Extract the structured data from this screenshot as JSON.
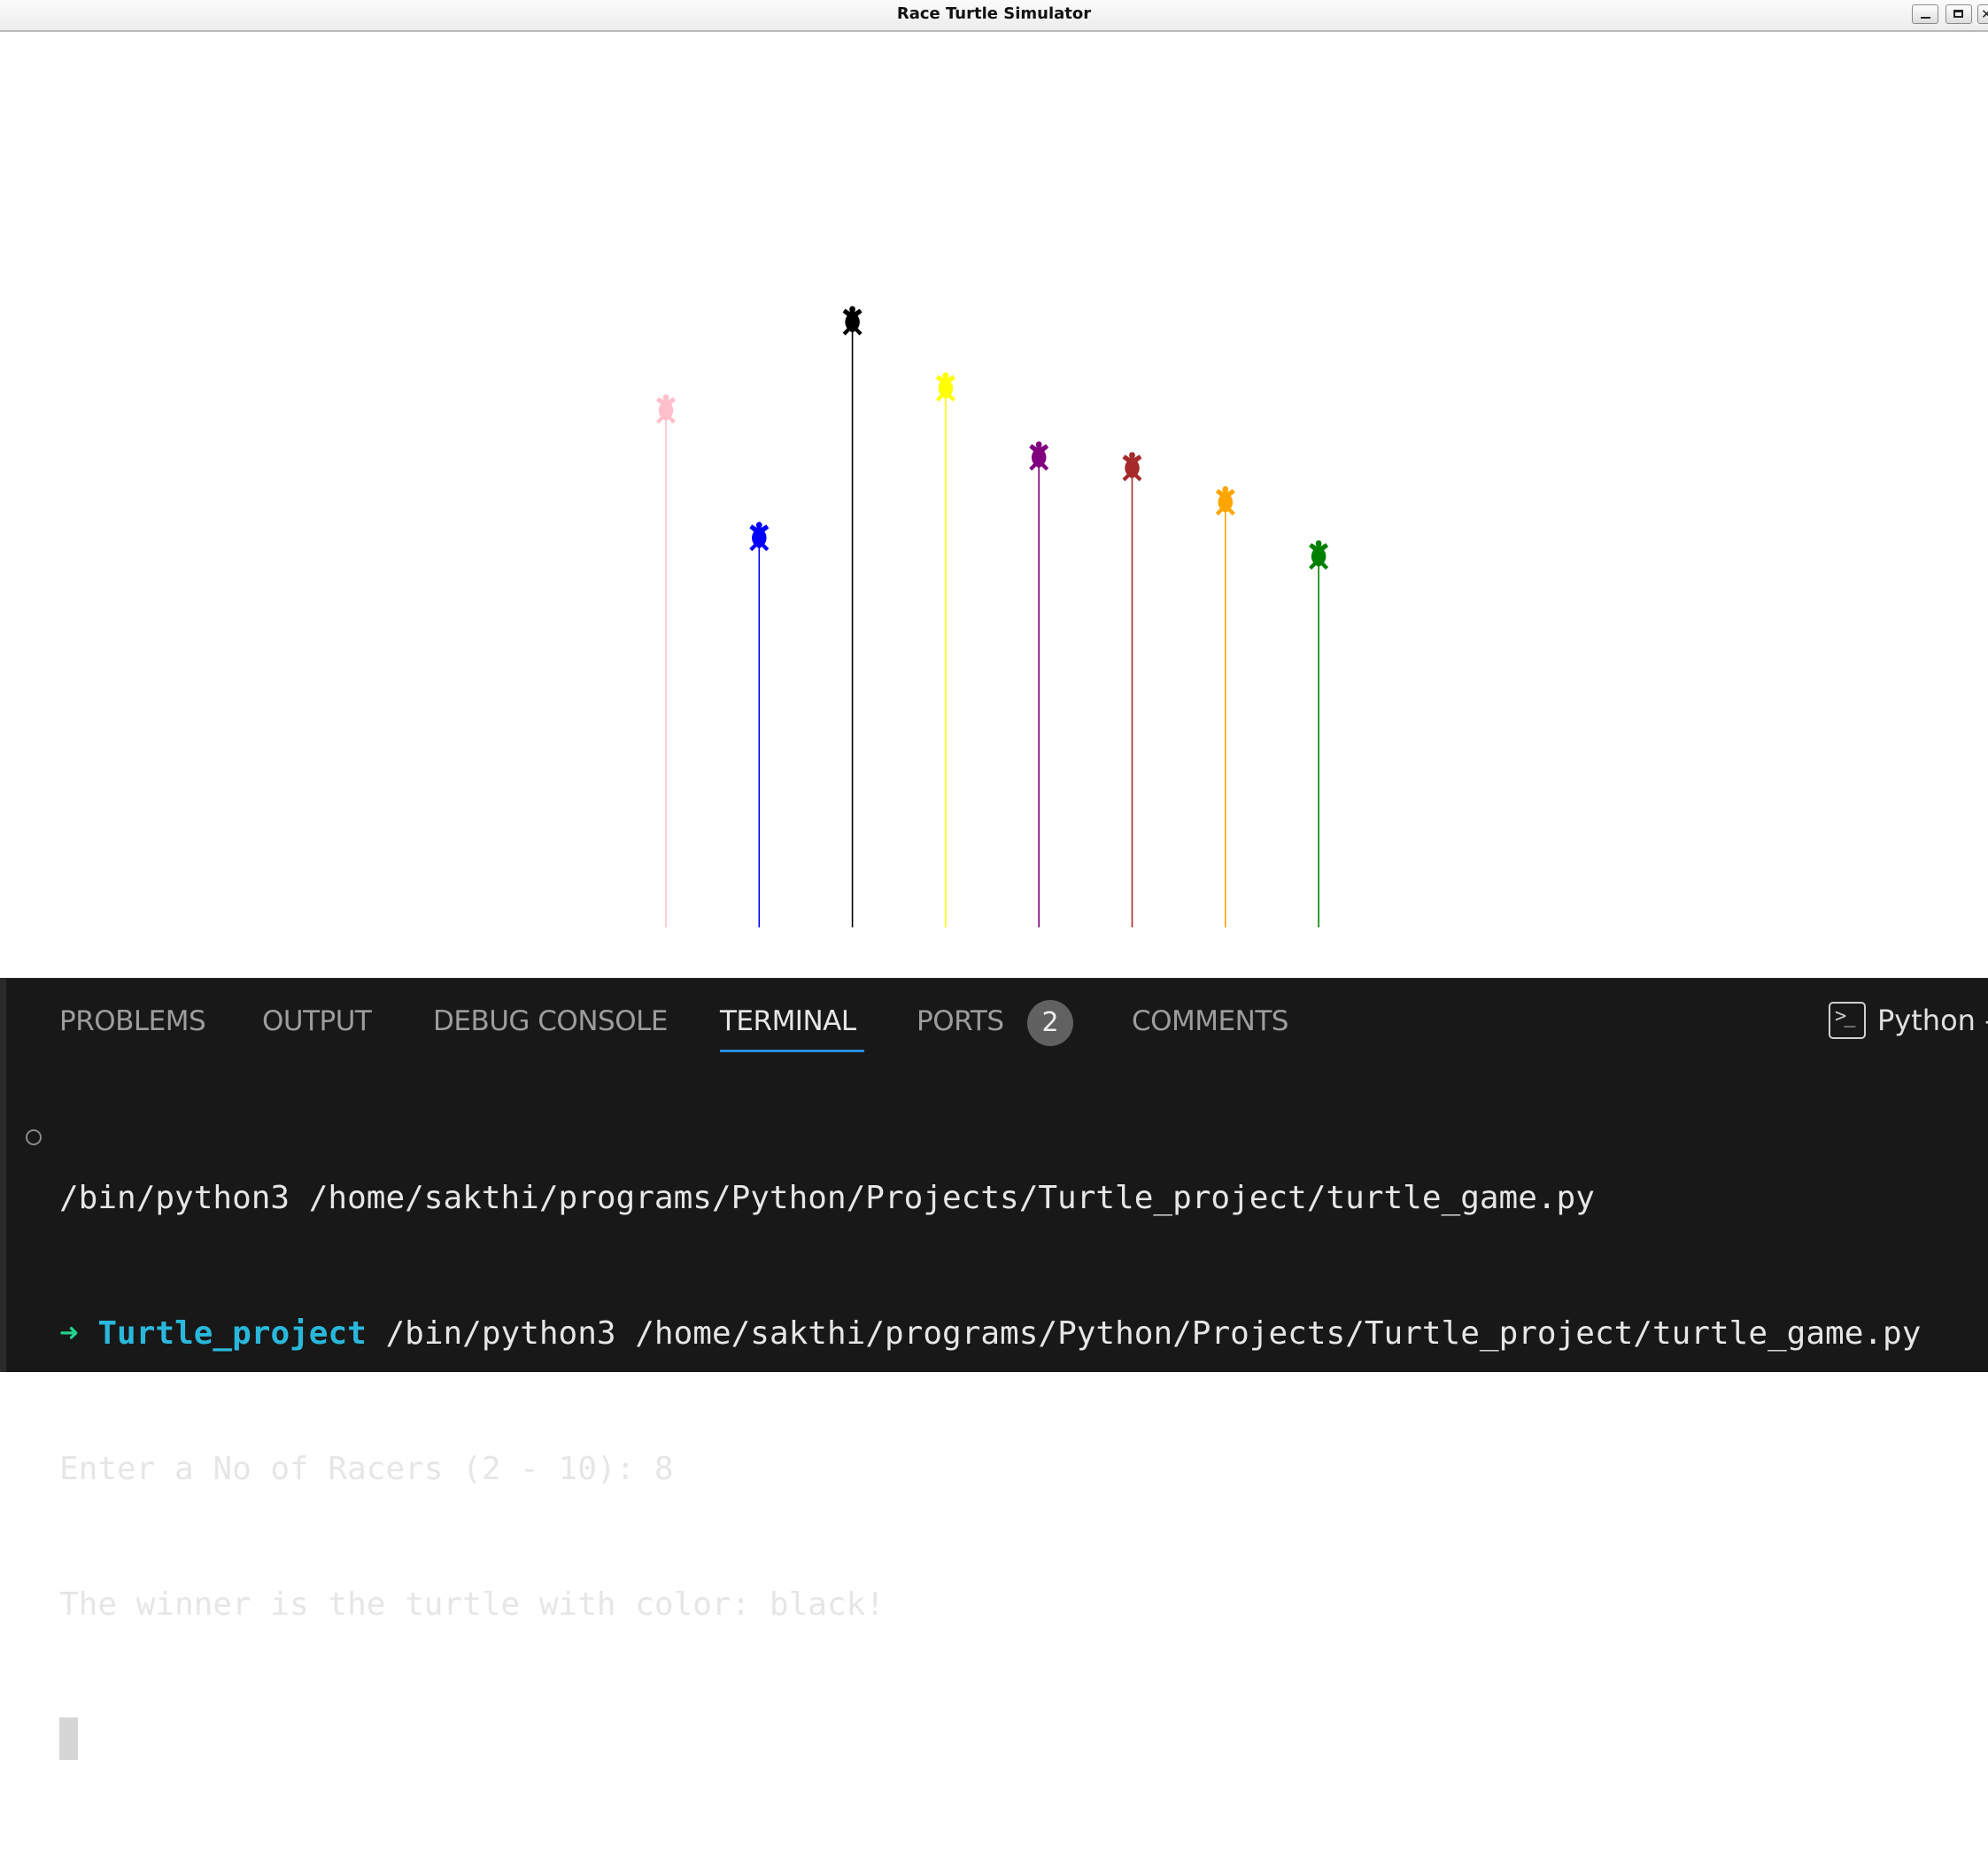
{
  "window": {
    "title": "Race Turtle Simulator",
    "controls": [
      "minimize",
      "maximize",
      "close"
    ],
    "close_glyph": "✕"
  },
  "race": {
    "racers": [
      {
        "color": "pink",
        "finish": 0.726
      },
      {
        "color": "blue",
        "finish": 0.547
      },
      {
        "color": "black",
        "finish": 0.85
      },
      {
        "color": "yellow",
        "finish": 0.757
      },
      {
        "color": "purple",
        "finish": 0.66
      },
      {
        "color": "brown",
        "finish": 0.645
      },
      {
        "color": "orange",
        "finish": 0.597
      },
      {
        "color": "green",
        "finish": 0.521
      }
    ],
    "colors": {
      "pink": "#ffc0cb",
      "blue": "#0000ff",
      "black": "#000000",
      "yellow": "#ffff00",
      "purple": "#800080",
      "brown": "#a52a2a",
      "orange": "#ffa500",
      "green": "#008000"
    }
  },
  "panel": {
    "tabs": {
      "problems": "PROBLEMS",
      "output": "OUTPUT",
      "debug_console": "DEBUG CONSOLE",
      "terminal": "TERMINAL",
      "ports": "PORTS",
      "ports_count": "2",
      "comments": "COMMENTS"
    },
    "active_tab": "TERMINAL",
    "shell_label": "Python -",
    "shell_icon": "terminal-icon"
  },
  "terminal": {
    "line1": "/bin/python3 /home/sakthi/programs/Python/Projects/Turtle_project/turtle_game.py",
    "prompt_arrow": "➜",
    "prompt_dir": "Turtle_project",
    "prompt_cmd": " /bin/python3 /home/sakthi/programs/Python/Projects/Turtle_project/turtle_game.py",
    "line3": "Enter a No of Racers (2 - 10): 8",
    "line4": "The winner is the turtle with color: black!"
  },
  "colors": {
    "accent": "#2b8bdb",
    "panel_bg": "#181818",
    "prompt_arrow": "#23d18b",
    "prompt_dir": "#29b8db"
  }
}
